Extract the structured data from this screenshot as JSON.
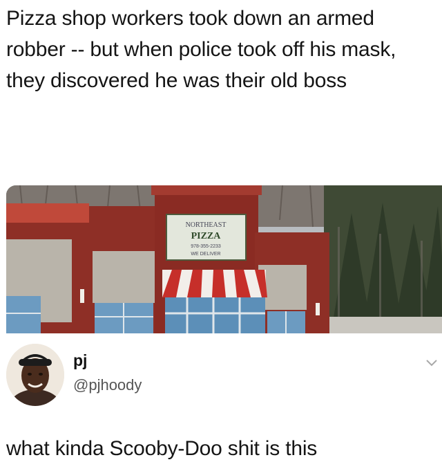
{
  "post": {
    "text": "Pizza shop workers took down an armed robber -- but when police took off his mask, they discovered he was their old boss"
  },
  "photo": {
    "sign_lines": [
      "NORTHEAST",
      "PIZZA",
      "978-355-2233",
      "WE DELIVER"
    ]
  },
  "reply": {
    "display_name": "pj",
    "handle": "@pjhoody",
    "text": "what kinda Scooby-Doo shit is this"
  },
  "icons": {
    "menu": "chevron-down-icon"
  }
}
